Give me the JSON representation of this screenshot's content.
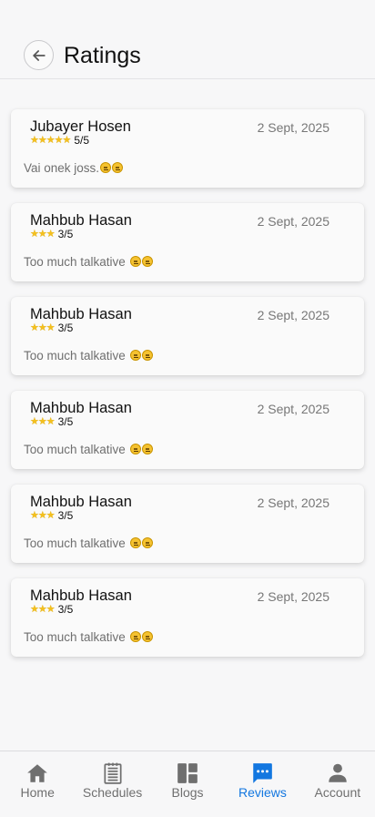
{
  "header": {
    "title": "Ratings",
    "back_icon": "arrow-left-icon"
  },
  "reviews": [
    {
      "name": "Jubayer Hosen",
      "date": "2 Sept, 2025",
      "stars": "★★★★★",
      "score": "5/5",
      "comment": "Vai onek joss."
    },
    {
      "name": "Mahbub Hasan",
      "date": "2 Sept, 2025",
      "stars": "★★★",
      "score": "3/5",
      "comment": "Too much talkative "
    },
    {
      "name": "Mahbub Hasan",
      "date": "2 Sept, 2025",
      "stars": "★★★",
      "score": "3/5",
      "comment": "Too much talkative "
    },
    {
      "name": "Mahbub Hasan",
      "date": "2 Sept, 2025",
      "stars": "★★★",
      "score": "3/5",
      "comment": "Too much talkative "
    },
    {
      "name": "Mahbub Hasan",
      "date": "2 Sept, 2025",
      "stars": "★★★",
      "score": "3/5",
      "comment": "Too much talkative "
    },
    {
      "name": "Mahbub Hasan",
      "date": "2 Sept, 2025",
      "stars": "★★★",
      "score": "3/5",
      "comment": "Too much talkative "
    }
  ],
  "tabs": [
    {
      "label": "Home",
      "icon": "home-icon",
      "active": false
    },
    {
      "label": "Schedules",
      "icon": "schedule-list-icon",
      "active": false
    },
    {
      "label": "Blogs",
      "icon": "blogs-grid-icon",
      "active": false
    },
    {
      "label": "Reviews",
      "icon": "chat-bubble-icon",
      "active": true
    },
    {
      "label": "Account",
      "icon": "person-icon",
      "active": false
    }
  ],
  "colors": {
    "accent": "#1377e0",
    "star": "#f4c01e",
    "muted": "#6f6f6f"
  }
}
